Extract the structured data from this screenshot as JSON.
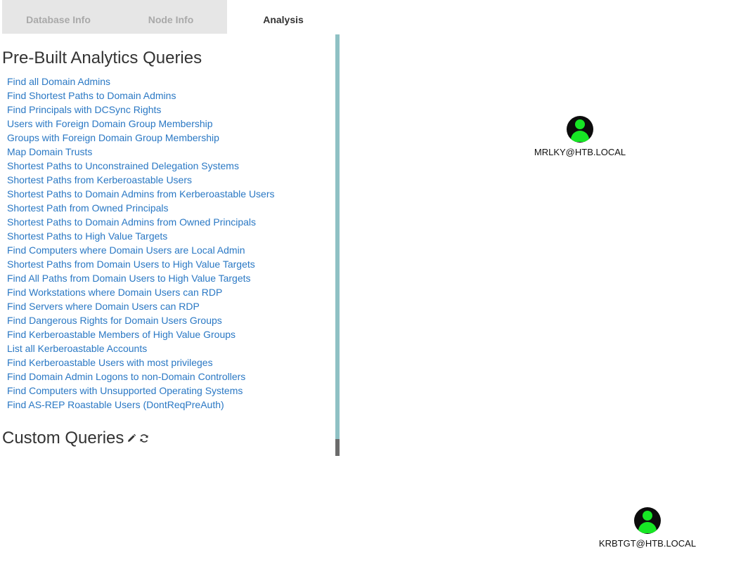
{
  "tabs": [
    {
      "label": "Database Info",
      "active": false
    },
    {
      "label": "Node Info",
      "active": false
    },
    {
      "label": "Analysis",
      "active": true
    }
  ],
  "analysis": {
    "prebuilt_title": "Pre-Built Analytics Queries",
    "queries": [
      "Find all Domain Admins",
      "Find Shortest Paths to Domain Admins",
      "Find Principals with DCSync Rights",
      "Users with Foreign Domain Group Membership",
      "Groups with Foreign Domain Group Membership",
      "Map Domain Trusts",
      "Shortest Paths to Unconstrained Delegation Systems",
      "Shortest Paths from Kerberoastable Users",
      "Shortest Paths to Domain Admins from Kerberoastable Users",
      "Shortest Path from Owned Principals",
      "Shortest Paths to Domain Admins from Owned Principals",
      "Shortest Paths to High Value Targets",
      "Find Computers where Domain Users are Local Admin",
      "Shortest Paths from Domain Users to High Value Targets",
      "Find All Paths from Domain Users to High Value Targets",
      "Find Workstations where Domain Users can RDP",
      "Find Servers where Domain Users can RDP",
      "Find Dangerous Rights for Domain Users Groups",
      "Find Kerberoastable Members of High Value Groups",
      "List all Kerberoastable Accounts",
      "Find Kerberoastable Users with most privileges",
      "Find Domain Admin Logons to non-Domain Controllers",
      "Find Computers with Unsupported Operating Systems",
      "Find AS-REP Roastable Users (DontReqPreAuth)"
    ],
    "custom_title": "Custom Queries"
  },
  "graph": {
    "nodes": [
      {
        "label": "MRLKY@HTB.LOCAL",
        "icon": "user-icon"
      },
      {
        "label": "KRBTGT@HTB.LOCAL",
        "icon": "user-icon"
      }
    ]
  },
  "colors": {
    "link": "#2a78c4",
    "node_icon": "#17e625",
    "node_bg": "#0c0c0c",
    "scrollbar": "#8fc1c4"
  }
}
